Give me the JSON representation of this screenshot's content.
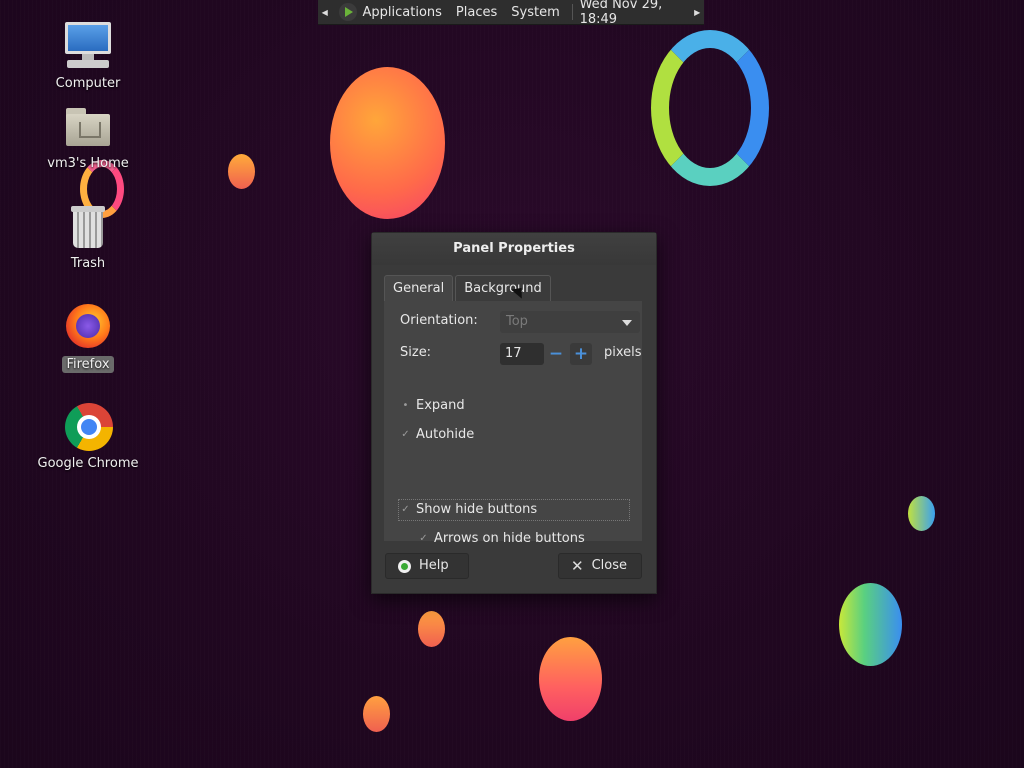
{
  "panel": {
    "menus": [
      "Applications",
      "Places",
      "System"
    ],
    "clock": "Wed Nov 29, 18:49"
  },
  "desktop": {
    "icons": [
      {
        "label": "Computer"
      },
      {
        "label": "vm3's Home"
      },
      {
        "label": "Trash"
      },
      {
        "label": "Firefox"
      },
      {
        "label": "Google Chrome"
      }
    ]
  },
  "dialog": {
    "title": "Panel Properties",
    "tabs": [
      "General",
      "Background"
    ],
    "active_tab": "General",
    "orientation_label": "Orientation:",
    "orientation_value": "Top",
    "size_label": "Size:",
    "size_value": "17",
    "size_unit": "pixels",
    "checkboxes": [
      {
        "label": "Expand",
        "checked": false
      },
      {
        "label": "Autohide",
        "checked": true
      },
      {
        "label": "Show hide buttons",
        "checked": true
      },
      {
        "label": "Arrows on hide buttons",
        "checked": true
      }
    ],
    "help_label": "Help",
    "close_label": "Close"
  }
}
